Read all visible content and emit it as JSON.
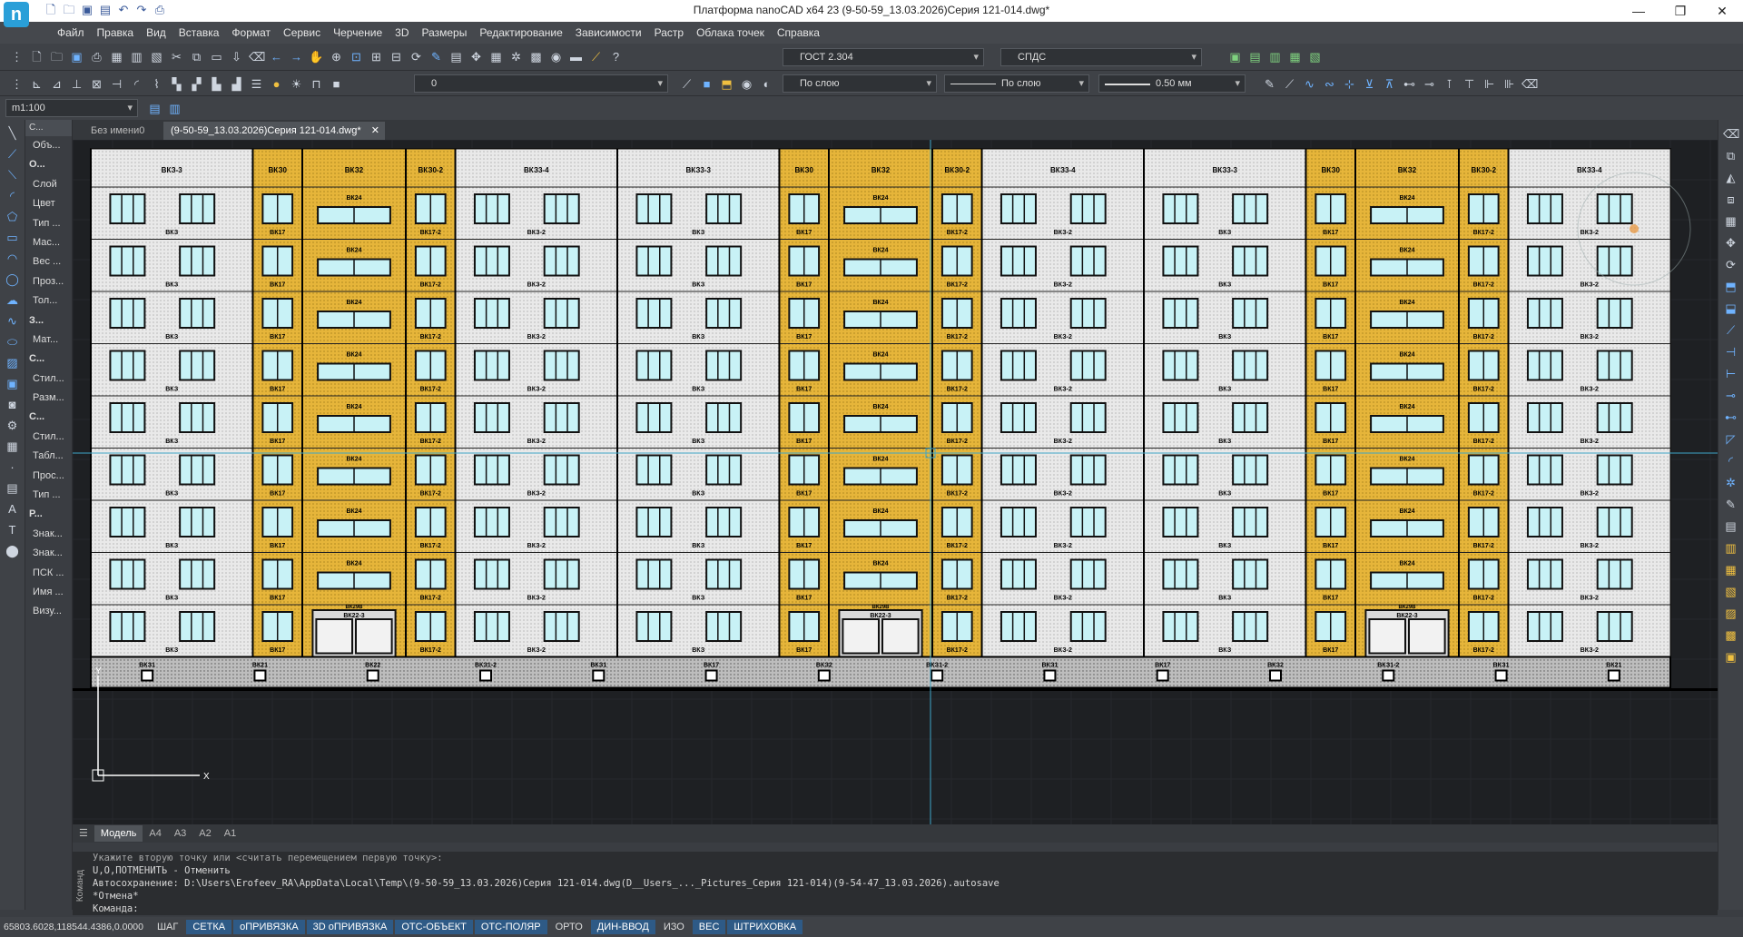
{
  "window": {
    "title": "Платформа nanoCAD x64 23 (9-50-59_13.03.2026)Серия 121-014.dwg*",
    "logo": "n"
  },
  "menu": [
    "Файл",
    "Правка",
    "Вид",
    "Вставка",
    "Формат",
    "Сервис",
    "Черчение",
    "3D",
    "Размеры",
    "Редактирование",
    "Зависимости",
    "Растр",
    "Облака точек",
    "Справка"
  ],
  "toolbar": {
    "text_style": "ГОСТ 2.304",
    "dim_style": "СПДС",
    "layer": "0",
    "color": "По слою",
    "linetype": "По слою",
    "lineweight": "0.50 мм",
    "scale": "m1:100"
  },
  "doc_tabs": [
    "Без имени0",
    "(9-50-59_13.03.2026)Серия 121-014.dwg*"
  ],
  "properties": {
    "header": "С...",
    "rows": [
      "Объ...",
      "О...",
      "Слой",
      "Цвет",
      "Тип ...",
      "Мас...",
      "Вес ...",
      "Проз...",
      "Тол...",
      "З...",
      "Мат...",
      "С...",
      "Стил...",
      "Разм...",
      "С...",
      "Стил...",
      "Табл...",
      "Прос...",
      "Тип ...",
      "Р...",
      "Знак...",
      "Знак...",
      "ПСК ...",
      "Имя ...",
      "Визу..."
    ]
  },
  "drawing": {
    "cols": [
      {
        "key": "p",
        "top": "ВКЗ-3",
        "win": "ВКЗ"
      },
      {
        "key": "n",
        "top": "ВКЗ0",
        "win": "ВК17"
      },
      {
        "key": "c",
        "top": "ВКЗ2",
        "win": "ВК24"
      },
      {
        "key": "n",
        "top": "ВКЗ0-2",
        "win": "ВК17-2"
      },
      {
        "key": "p",
        "top": "ВКЗ3-4",
        "win": "ВКЗ-2"
      },
      {
        "key": "p",
        "top": "ВКЗ3-3",
        "win": "ВКЗ"
      },
      {
        "key": "n",
        "top": "ВКЗ0",
        "win": "ВК17"
      },
      {
        "key": "c",
        "top": "ВКЗ2",
        "win": "ВК24"
      },
      {
        "key": "n",
        "top": "ВКЗ0-2",
        "win": "ВК17-2"
      },
      {
        "key": "p",
        "top": "ВКЗ3-4",
        "win": "ВКЗ-2"
      },
      {
        "key": "p",
        "top": "ВКЗ3-3",
        "win": "ВКЗ"
      },
      {
        "key": "n",
        "top": "ВКЗ0",
        "win": "ВК17"
      },
      {
        "key": "c",
        "top": "ВКЗ2",
        "win": "ВК24"
      },
      {
        "key": "n",
        "top": "ВКЗ0-2",
        "win": "ВК17-2"
      },
      {
        "key": "p",
        "top": "ВКЗ3-4",
        "win": "ВКЗ-2"
      }
    ],
    "floors": 9,
    "entrance_label": "ВК22-3",
    "entrance_top": "ВК29В",
    "basement_labels": [
      "ВКЗ1",
      "ВК21",
      "ВК22",
      "ВКЗ1-2",
      "ВКЗ1",
      "ВК17",
      "ВКЗ2",
      "ВКЗ1-2",
      "ВКЗ1",
      "ВК17",
      "ВКЗ2",
      "ВКЗ1-2",
      "ВКЗ1",
      "ВК21"
    ],
    "ucs_y": "Y",
    "ucs_x": "X",
    "colors": {
      "panel": "#e8e8e8",
      "accent": "#e6b53a",
      "window": "#c8f2f6",
      "grid": "#2a2c30"
    }
  },
  "layout_tabs": [
    "Модель",
    "А4",
    "А3",
    "А2",
    "А1"
  ],
  "command": {
    "label": "Команд",
    "lines": [
      "Укажите вторую точку или <считать перемещением первую точку>:",
      "U,O,ПОТМЕНИТЬ - Отменить",
      "Автосохранение: D:\\Users\\Erofeev_RA\\AppData\\Local\\Temp\\(9-50-59_13.03.2026)Серия 121-014.dwg(D__Users_..._Pictures_Серия 121-014)(9-54-47_13.03.2026).autosave",
      "*Отмена*",
      "Команда:"
    ]
  },
  "status": {
    "coords": "65803.6028,118544.4386,0.0000",
    "modes": [
      {
        "label": "ШАГ",
        "on": false
      },
      {
        "label": "СЕТКА",
        "on": true
      },
      {
        "label": "оПРИВЯЗКА",
        "on": true
      },
      {
        "label": "3D оПРИВЯЗКА",
        "on": true
      },
      {
        "label": "ОТС-ОБЪЕКТ",
        "on": true
      },
      {
        "label": "ОТС-ПОЛЯР",
        "on": true
      },
      {
        "label": "ОРТО",
        "on": false
      },
      {
        "label": "ДИН-ВВОД",
        "on": true
      },
      {
        "label": "ИЗО",
        "on": false
      },
      {
        "label": "ВЕС",
        "on": true
      },
      {
        "label": "ШТРИХОВКА",
        "on": true
      }
    ]
  }
}
